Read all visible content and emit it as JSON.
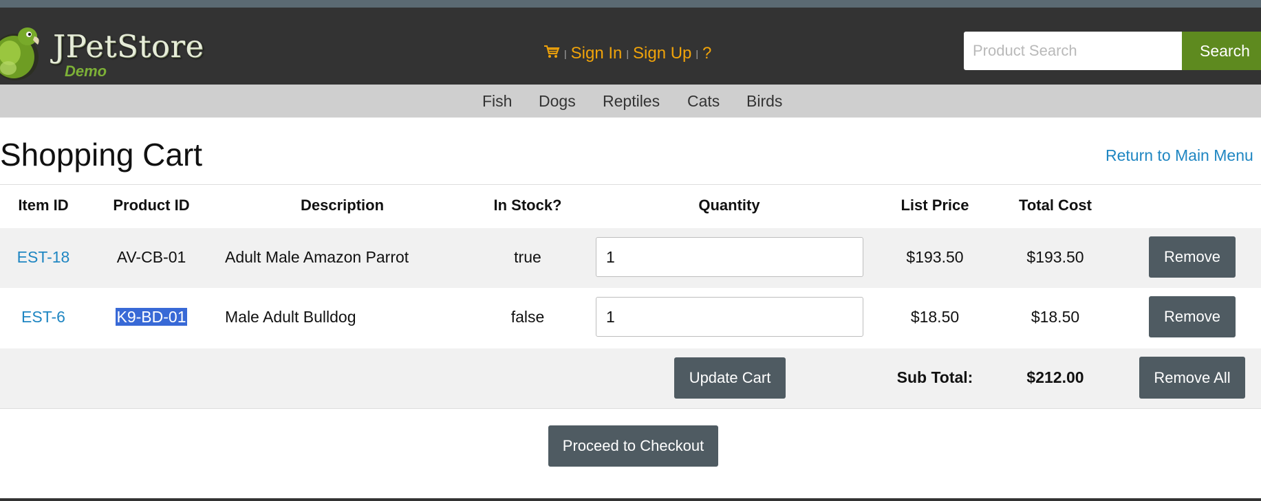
{
  "header": {
    "logo_text": "JPetStore",
    "logo_sub": "Demo",
    "cart_icon": "cart-icon",
    "sign_in": "Sign In",
    "sign_up": "Sign Up",
    "help": "?",
    "separator": "|",
    "search_placeholder": "Product Search",
    "search_button": "Search"
  },
  "categories": [
    "Fish",
    "Dogs",
    "Reptiles",
    "Cats",
    "Birds"
  ],
  "page": {
    "title": "Shopping Cart",
    "return_link": "Return to Main Menu"
  },
  "table": {
    "headers": [
      "Item ID",
      "Product ID",
      "Description",
      "In Stock?",
      "Quantity",
      "List Price",
      "Total Cost"
    ],
    "rows": [
      {
        "item_id": "EST-18",
        "product_id": "AV-CB-01",
        "description": "Adult Male Amazon Parrot",
        "in_stock": "true",
        "quantity": "1",
        "list_price": "$193.50",
        "total_cost": "$193.50",
        "remove": "Remove"
      },
      {
        "item_id": "EST-6",
        "product_id": "K9-BD-01",
        "description": "Male Adult Bulldog",
        "in_stock": "false",
        "quantity": "1",
        "list_price": "$18.50",
        "total_cost": "$18.50",
        "remove": "Remove"
      }
    ],
    "update_cart": "Update Cart",
    "subtotal_label": "Sub Total:",
    "subtotal_value": "$212.00",
    "remove_all": "Remove All"
  },
  "checkout_button": "Proceed to Checkout",
  "colors": {
    "header_bg": "#333333",
    "link_orange": "#f0a30a",
    "search_green": "#5e8a1f",
    "link_blue": "#1f86c2",
    "button_gray": "#4f5b62",
    "selection_blue": "#3869d6"
  }
}
